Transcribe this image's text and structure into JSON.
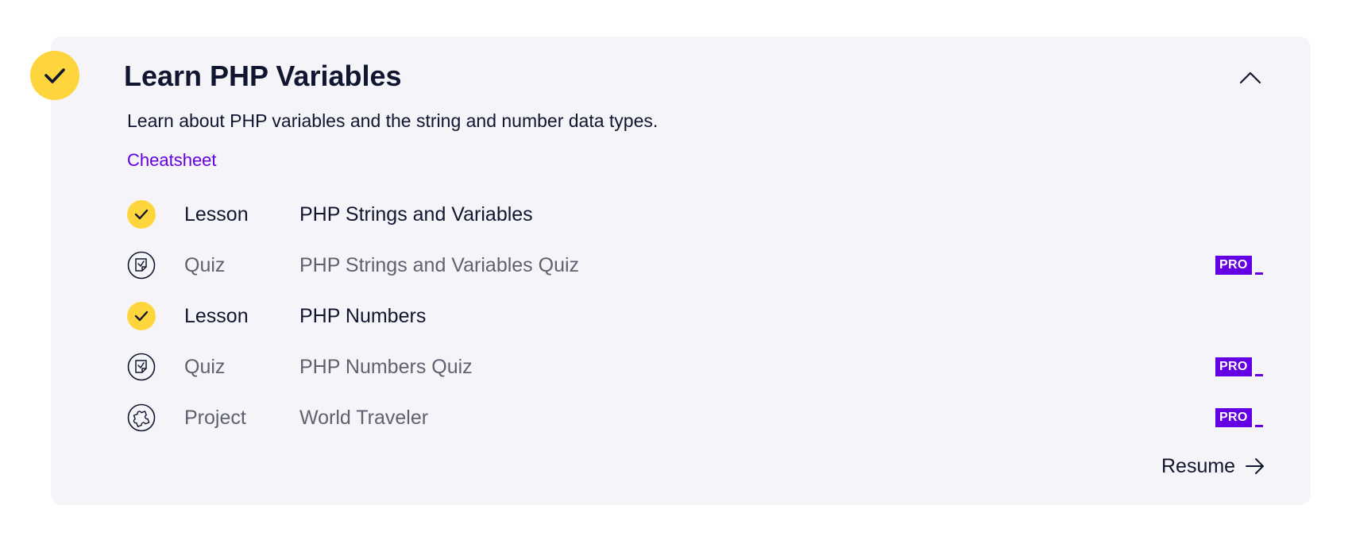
{
  "module": {
    "title": "Learn PHP Variables",
    "description": "Learn about PHP variables and the string and number data types.",
    "cheatsheet_label": "Cheatsheet",
    "completed_icon": "check-icon",
    "collapse_icon": "chevron-up-icon",
    "colors": {
      "card_background": "#f5f4f9",
      "completed_yellow": "#ffd53d",
      "link_purple": "#6400e4",
      "pro_purple": "#6400e4",
      "text_dark": "#10162f",
      "text_muted": "#5f6170"
    }
  },
  "items": [
    {
      "type": "Lesson",
      "title": "PHP Strings and Variables",
      "status": "completed",
      "icon": "check-icon",
      "pro": false
    },
    {
      "type": "Quiz",
      "title": "PHP Strings and Variables Quiz",
      "status": "locked",
      "icon": "quiz-icon",
      "pro": true,
      "pro_label": "PRO"
    },
    {
      "type": "Lesson",
      "title": "PHP Numbers",
      "status": "completed",
      "icon": "check-icon",
      "pro": false
    },
    {
      "type": "Quiz",
      "title": "PHP Numbers Quiz",
      "status": "locked",
      "icon": "quiz-icon",
      "pro": true,
      "pro_label": "PRO"
    },
    {
      "type": "Project",
      "title": "World Traveler",
      "status": "locked",
      "icon": "puzzle-icon",
      "pro": true,
      "pro_label": "PRO"
    }
  ],
  "resume": {
    "label": "Resume",
    "icon": "arrow-right-icon"
  }
}
